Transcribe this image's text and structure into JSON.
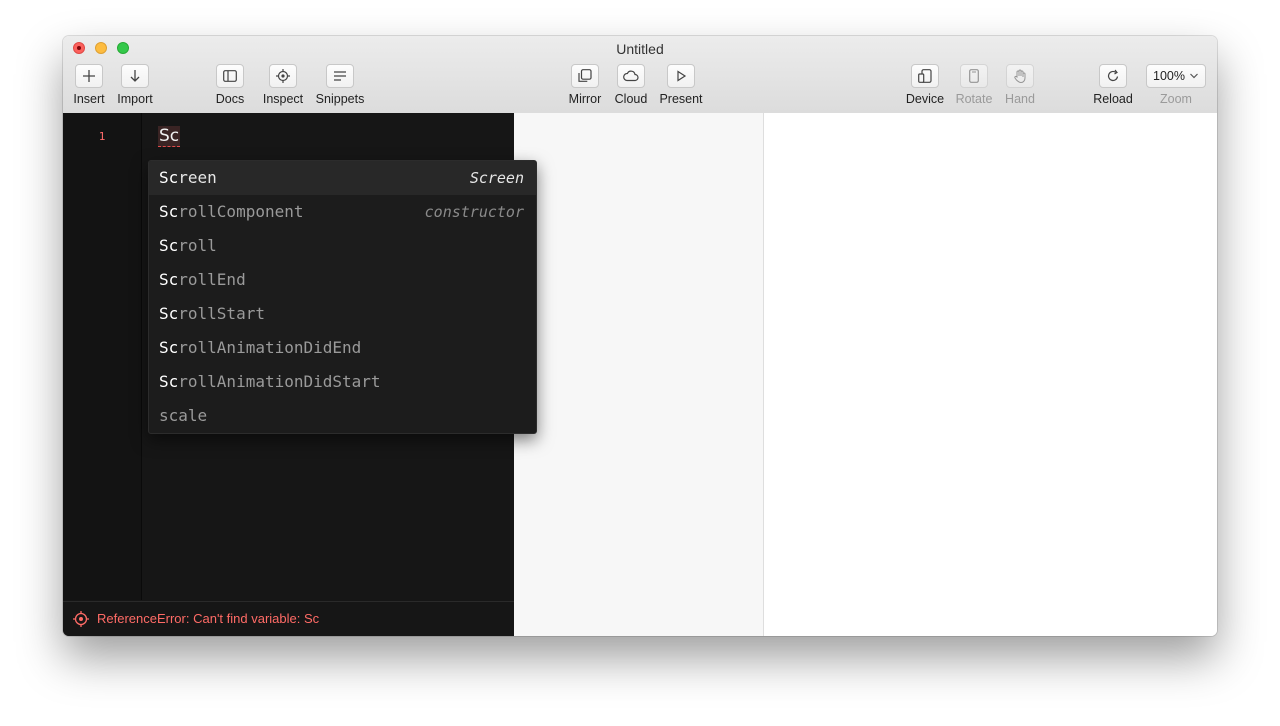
{
  "window": {
    "title": "Untitled"
  },
  "toolbar": {
    "insert": "Insert",
    "import": "Import",
    "docs": "Docs",
    "inspect": "Inspect",
    "snippets": "Snippets",
    "mirror": "Mirror",
    "cloud": "Cloud",
    "present": "Present",
    "device": "Device",
    "rotate": "Rotate",
    "hand": "Hand",
    "reload": "Reload",
    "zoom_value": "100%",
    "zoom_label": "Zoom"
  },
  "editor": {
    "line_number": "1",
    "code": "Sc",
    "error": "ReferenceError: Can't find variable: Sc"
  },
  "autocomplete": {
    "typed": "Sc",
    "items": [
      {
        "typed": "Sc",
        "rest": "reen",
        "hint": "Screen"
      },
      {
        "typed": "Sc",
        "rest": "rollComponent",
        "hint": "constructor"
      },
      {
        "typed": "Sc",
        "rest": "roll",
        "hint": ""
      },
      {
        "typed": "Sc",
        "rest": "rollEnd",
        "hint": ""
      },
      {
        "typed": "Sc",
        "rest": "rollStart",
        "hint": ""
      },
      {
        "typed": "Sc",
        "rest": "rollAnimationDidEnd",
        "hint": ""
      },
      {
        "typed": "Sc",
        "rest": "rollAnimationDidStart",
        "hint": ""
      },
      {
        "typed": "",
        "rest": "scale",
        "hint": ""
      }
    ]
  },
  "colors": {
    "error": "#ff6b66",
    "editor_bg": "#161616",
    "close": "#fc605c",
    "minimize": "#fdbc40",
    "maximize": "#34c84a"
  }
}
